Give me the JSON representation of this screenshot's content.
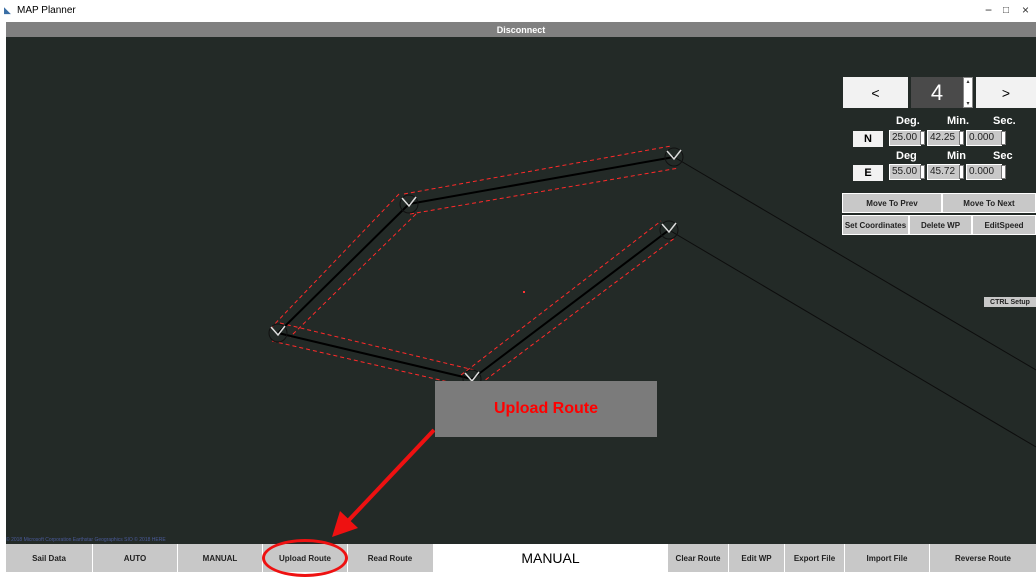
{
  "window": {
    "title": "MAP Planner",
    "minimize": "−",
    "maximize": "□",
    "close": "×"
  },
  "connection": {
    "button_label": "Disconnect"
  },
  "waypoint_panel": {
    "prev_label": "<",
    "next_label": ">",
    "waypoint_number": "4",
    "latitude": {
      "headers": [
        "Deg.",
        "Min.",
        "Sec."
      ],
      "hemisphere": "N",
      "deg": "25.00",
      "min": "42.25",
      "sec": "0.000"
    },
    "longitude": {
      "headers": [
        "Deg",
        "Min",
        "Sec"
      ],
      "hemisphere": "E",
      "deg": "55.00",
      "min": "45.72",
      "sec": "0.000"
    },
    "move_to_prev": "Move To Prev",
    "move_to_next": "Move To Next",
    "set_coordinates": "Set Coordinates",
    "delete_wp": "Delete WP",
    "edit_speed": "EditSpeed"
  },
  "ctrl_setup": "CTRL Setup",
  "map": {
    "attribution": "© 2018 Microsoft Corporation  Earthstar Geographics SIO  © 2018 HERE"
  },
  "callout": {
    "text": "Upload Route",
    "color": "#ff0000"
  },
  "bottom_bar": {
    "buttons": [
      "Sail Data",
      "AUTO",
      "MANUAL",
      "Upload Route",
      "Read Route",
      "Clear Route",
      "Edit WP",
      "Export File",
      "Import File",
      "Reverse Route"
    ],
    "mode_label": "MANUAL"
  },
  "colors": {
    "map_background": "#232a27",
    "route_line": "#000000",
    "route_buffer": "#ff2a2a",
    "highlight": "#ee1111"
  }
}
